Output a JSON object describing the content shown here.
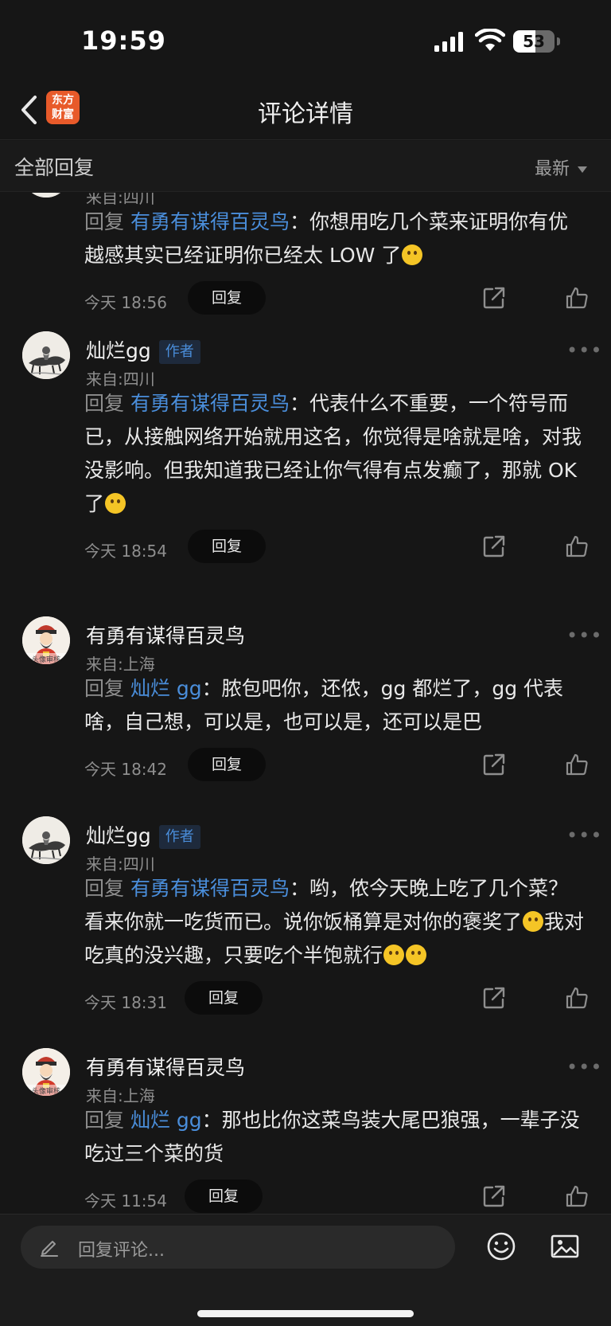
{
  "status_bar": {
    "time": "19:59",
    "battery": "53",
    "battery_level": 0.53
  },
  "nav": {
    "title": "评论详情",
    "logo_line1": "东方",
    "logo_line2": "财富"
  },
  "section": {
    "title": "全部回复",
    "sort": "最新"
  },
  "reply_label": "回复",
  "comments": [
    {
      "name": "",
      "author": false,
      "location": "来自:四川",
      "reply_prefix": "回复",
      "reply_to": "有勇有谋得百灵鸟",
      "separator": "：",
      "text": "你想用吃几个菜来证明你有优越感其实已经证明你已经太 LOW 了",
      "emoji_count": 1,
      "time": "今天 18:56",
      "avatar": "ink-painting-avatar"
    },
    {
      "name": "灿烂gg",
      "author": true,
      "author_label": "作者",
      "location": "来自:四川",
      "reply_prefix": "回复",
      "reply_to": "有勇有谋得百灵鸟",
      "separator": "：",
      "text": "代表什么不重要，一个符号而已，从接触网络开始就用这名，你觉得是啥就是啥，对我没影响。但我知道我已经让你气得有点发癫了，那就 OK 了",
      "emoji_count": 1,
      "time": "今天 18:54",
      "avatar": "ink-painting-avatar"
    },
    {
      "name": "有勇有谋得百灵鸟",
      "author": false,
      "location": "来自:上海",
      "reply_prefix": "回复",
      "reply_to": "灿烂 gg",
      "separator": "：",
      "text": "脓包吧你，还侬，gg 都烂了，gg 代表啥，自己想，可以是，也可以是，还可以是巴",
      "emoji_count": 0,
      "time": "今天 18:42",
      "avatar": "fortune-god-avatar",
      "avatar_caption": "头像审核"
    },
    {
      "name": "灿烂gg",
      "author": true,
      "author_label": "作者",
      "location": "来自:四川",
      "reply_prefix": "回复",
      "reply_to": "有勇有谋得百灵鸟",
      "separator": "：",
      "text_a": "哟，侬今天晚上吃了几个菜？看来你就一吃货而已。说你饭桶算是对你的褒奖了",
      "text_b": "我对吃真的没兴趣，只要吃个半饱就行",
      "time": "今天 18:31",
      "avatar": "ink-painting-avatar"
    },
    {
      "name": "有勇有谋得百灵鸟",
      "author": false,
      "location": "来自:上海",
      "reply_prefix": "回复",
      "reply_to": "灿烂 gg",
      "separator": "：",
      "text": "那也比你这菜鸟装大尾巴狼强，一辈子没吃过三个菜的货",
      "emoji_count": 0,
      "time": "今天 11:54",
      "avatar": "fortune-god-avatar",
      "avatar_caption": "头像审核"
    }
  ],
  "bottom": {
    "placeholder": "回复评论..."
  },
  "colors": {
    "link": "#4a8edb",
    "background": "#161616",
    "logo": "#e85a2a"
  }
}
